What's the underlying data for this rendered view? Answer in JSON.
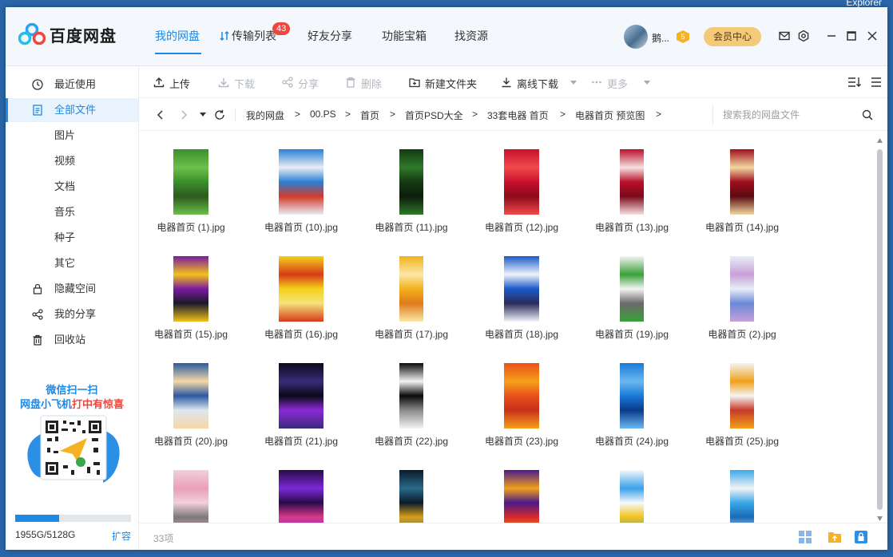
{
  "desktop": {
    "corner_text": "Explorer"
  },
  "app": {
    "name": "百度网盘"
  },
  "nav": {
    "tabs": [
      "我的网盘",
      "传输列表",
      "好友分享",
      "功能宝箱",
      "找资源"
    ],
    "transfer_badge": "43"
  },
  "user": {
    "name": "鹅...",
    "level": "5",
    "vip_label": "会员中心"
  },
  "sidebar": {
    "items": [
      "最近使用",
      "全部文件",
      "图片",
      "视频",
      "文档",
      "音乐",
      "种子",
      "其它",
      "隐藏空间",
      "我的分享",
      "回收站"
    ],
    "promo_line1": "微信扫一扫",
    "promo_line2a": "网盘小飞机",
    "promo_line2b": "打中有惊喜",
    "storage_used_fraction": 0.38,
    "storage_text": "1955G/5128G",
    "expand_label": "扩容"
  },
  "toolbar": {
    "upload": "上传",
    "download": "下载",
    "share": "分享",
    "delete": "删除",
    "new_folder": "新建文件夹",
    "offline": "离线下载",
    "more": "更多"
  },
  "breadcrumb": [
    "我的网盘",
    "00.PS",
    "首页",
    "首页PSD大全",
    "33套电器 首页",
    "电器首页 预览图"
  ],
  "search": {
    "placeholder": "搜索我的网盘文件"
  },
  "files": [
    "电器首页 (1).jpg",
    "电器首页 (10).jpg",
    "电器首页 (11).jpg",
    "电器首页 (12).jpg",
    "电器首页 (13).jpg",
    "电器首页 (14).jpg",
    "电器首页 (15).jpg",
    "电器首页 (16).jpg",
    "电器首页 (17).jpg",
    "电器首页 (18).jpg",
    "电器首页 (19).jpg",
    "电器首页 (2).jpg",
    "电器首页 (20).jpg",
    "电器首页 (21).jpg",
    "电器首页 (22).jpg",
    "电器首页 (23).jpg",
    "电器首页 (24).jpg",
    "电器首页 (25).jpg",
    "",
    "",
    "",
    "",
    "",
    ""
  ],
  "thumb_colors": [
    [
      "#3a8f2c",
      "#6cc04a",
      "#2d5a1e"
    ],
    [
      "#2a7fd4",
      "#e8eef5",
      "#d23a2a"
    ],
    [
      "#143a14",
      "#2f7a2a",
      "#0c1c0c"
    ],
    [
      "#c8102e",
      "#f04a4a",
      "#8a0a1a"
    ],
    [
      "#b8102a",
      "#f6e0e0",
      "#7a0a1a"
    ],
    [
      "#a00e1e",
      "#f2d7a0",
      "#5a0a10"
    ],
    [
      "#7a1aa0",
      "#f2c21a",
      "#1a1a2a"
    ],
    [
      "#f2d21a",
      "#d83a1a",
      "#f6e27a"
    ],
    [
      "#f2b21a",
      "#fbe7a8",
      "#e07a1a"
    ],
    [
      "#1a5ac8",
      "#f0f4fa",
      "#2a2a5a"
    ],
    [
      "#f4f4f4",
      "#3aa03a",
      "#6a6a6a"
    ],
    [
      "#e8eef6",
      "#c7a0d8",
      "#6a8ad8"
    ],
    [
      "#2a5aa0",
      "#f6d7a8",
      "#e0e6ee"
    ],
    [
      "#0a0a1a",
      "#3a2a7a",
      "#8a2ad8"
    ],
    [
      "#0a0a0a",
      "#f4f4f4",
      "#8a8a8a"
    ],
    [
      "#e8501a",
      "#f6a01a",
      "#c8301a"
    ],
    [
      "#1a7ad8",
      "#6ab8f0",
      "#0a3a8a"
    ],
    [
      "#f4f4f4",
      "#f2a01a",
      "#c83a2a"
    ],
    [
      "#f2d0da",
      "#e8a0b8",
      "#7a7a7a"
    ],
    [
      "#2a0a4a",
      "#7a2ad8",
      "#d83a8a"
    ],
    [
      "#0a1a2a",
      "#2a6a8a",
      "#d8a01a"
    ],
    [
      "#4a1a8a",
      "#f2a01a",
      "#d82a2a"
    ],
    [
      "#f4f8fc",
      "#3aa0e8",
      "#f2c21a"
    ],
    [
      "#3aa8e8",
      "#f4f4f4",
      "#1a6ab8"
    ]
  ],
  "footer": {
    "count": "33项"
  }
}
